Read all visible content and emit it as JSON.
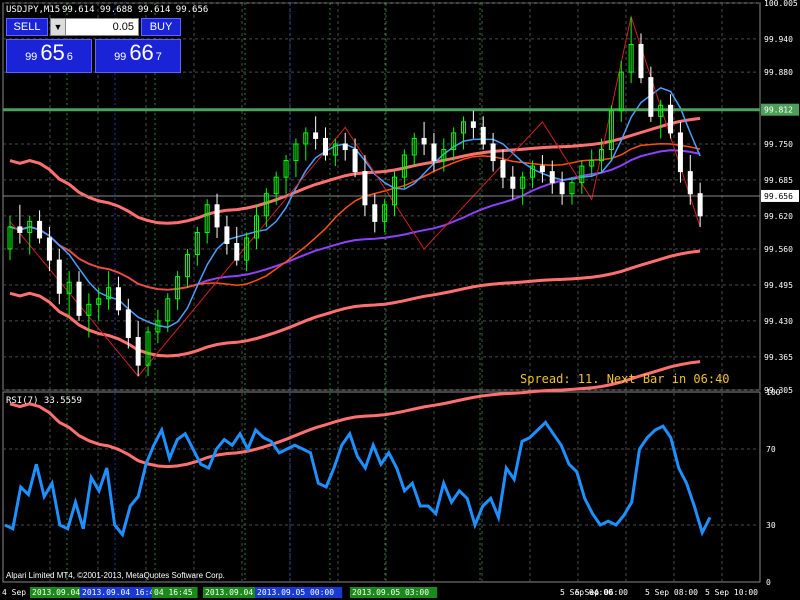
{
  "header": {
    "symbol_info": "USDJPY,M15",
    "ohlc": "99.614 99.688 99.614 99.656"
  },
  "trade_panel": {
    "sell_label": "SELL",
    "buy_label": "BUY",
    "lot_value": "0.05",
    "bid_prefix": "99",
    "bid_big": "65",
    "bid_sup": "6",
    "ask_prefix": "99",
    "ask_big": "66",
    "ask_sup": "7"
  },
  "status": {
    "spread_text": "Spread: 11. Next Bar in 06:40",
    "copyright": "Alpari Limited MT4, ©2001-2013, MetaQuotes Software Corp."
  },
  "colors": {
    "bull": "#00ff00",
    "bear": "#ffffff",
    "grid": "#4a4a4a",
    "hline": "#4ca05a",
    "rsi": "#1e90ff",
    "spread": "#f0c030"
  },
  "chart_data": [
    {
      "type": "candlestick",
      "title": "USDJPY,M15",
      "ylim": [
        99.305,
        100.005
      ],
      "y_ticks": [
        100.005,
        99.94,
        99.88,
        99.812,
        99.75,
        99.685,
        99.656,
        99.62,
        99.56,
        99.495,
        99.43,
        99.365,
        99.305
      ],
      "highlight_level": 99.812,
      "current_price": 99.656,
      "candles": [
        [
          99.56,
          99.62,
          99.54,
          99.6
        ],
        [
          99.6,
          99.64,
          99.57,
          99.59
        ],
        [
          99.59,
          99.62,
          99.55,
          99.61
        ],
        [
          99.61,
          99.63,
          99.57,
          99.58
        ],
        [
          99.58,
          99.6,
          99.52,
          99.54
        ],
        [
          99.54,
          99.56,
          99.46,
          99.48
        ],
        [
          99.48,
          99.52,
          99.44,
          99.5
        ],
        [
          99.5,
          99.52,
          99.43,
          99.44
        ],
        [
          99.44,
          99.48,
          99.4,
          99.46
        ],
        [
          99.46,
          99.49,
          99.43,
          99.47
        ],
        [
          99.47,
          99.52,
          99.45,
          99.49
        ],
        [
          99.49,
          99.51,
          99.44,
          99.45
        ],
        [
          99.45,
          99.47,
          99.38,
          99.4
        ],
        [
          99.4,
          99.43,
          99.33,
          99.35
        ],
        [
          99.35,
          99.42,
          99.33,
          99.41
        ],
        [
          99.41,
          99.45,
          99.39,
          99.43
        ],
        [
          99.43,
          99.48,
          99.41,
          99.47
        ],
        [
          99.47,
          99.52,
          99.45,
          99.51
        ],
        [
          99.51,
          99.56,
          99.49,
          99.55
        ],
        [
          99.55,
          99.6,
          99.53,
          99.59
        ],
        [
          99.59,
          99.65,
          99.57,
          99.64
        ],
        [
          99.64,
          99.66,
          99.58,
          99.6
        ],
        [
          99.6,
          99.62,
          99.55,
          99.57
        ],
        [
          99.57,
          99.6,
          99.53,
          99.54
        ],
        [
          99.54,
          99.59,
          99.52,
          99.58
        ],
        [
          99.58,
          99.64,
          99.56,
          99.62
        ],
        [
          99.62,
          99.67,
          99.6,
          99.66
        ],
        [
          99.66,
          99.7,
          99.64,
          99.69
        ],
        [
          99.69,
          99.73,
          99.66,
          99.72
        ],
        [
          99.72,
          99.76,
          99.69,
          99.75
        ],
        [
          99.75,
          99.78,
          99.72,
          99.77
        ],
        [
          99.77,
          99.8,
          99.74,
          99.76
        ],
        [
          99.76,
          99.78,
          99.72,
          99.73
        ],
        [
          99.73,
          99.76,
          99.71,
          99.75
        ],
        [
          99.75,
          99.77,
          99.72,
          99.74
        ],
        [
          99.74,
          99.76,
          99.69,
          99.7
        ],
        [
          99.7,
          99.73,
          99.62,
          99.64
        ],
        [
          99.64,
          99.66,
          99.59,
          99.61
        ],
        [
          99.61,
          99.65,
          99.59,
          99.64
        ],
        [
          99.64,
          99.7,
          99.62,
          99.69
        ],
        [
          99.69,
          99.74,
          99.67,
          99.73
        ],
        [
          99.73,
          99.77,
          99.71,
          99.76
        ],
        [
          99.76,
          99.79,
          99.73,
          99.75
        ],
        [
          99.75,
          99.77,
          99.7,
          99.72
        ],
        [
          99.72,
          99.76,
          99.7,
          99.74
        ],
        [
          99.74,
          99.78,
          99.72,
          99.77
        ],
        [
          99.77,
          99.8,
          99.74,
          99.79
        ],
        [
          99.79,
          99.81,
          99.76,
          99.78
        ],
        [
          99.78,
          99.8,
          99.74,
          99.75
        ],
        [
          99.75,
          99.77,
          99.7,
          99.72
        ],
        [
          99.72,
          99.74,
          99.67,
          99.69
        ],
        [
          99.69,
          99.71,
          99.65,
          99.67
        ],
        [
          99.67,
          99.7,
          99.64,
          99.69
        ],
        [
          99.69,
          99.72,
          99.67,
          99.71
        ],
        [
          99.71,
          99.73,
          99.68,
          99.7
        ],
        [
          99.7,
          99.72,
          99.66,
          99.68
        ],
        [
          99.68,
          99.7,
          99.64,
          99.66
        ],
        [
          99.66,
          99.69,
          99.64,
          99.68
        ],
        [
          99.68,
          99.72,
          99.66,
          99.71
        ],
        [
          99.71,
          99.74,
          99.69,
          99.72
        ],
        [
          99.72,
          99.76,
          99.7,
          99.74
        ],
        [
          99.74,
          99.82,
          99.72,
          99.81
        ],
        [
          99.81,
          99.9,
          99.79,
          99.88
        ],
        [
          99.88,
          99.98,
          99.86,
          99.93
        ],
        [
          99.93,
          99.95,
          99.86,
          99.87
        ],
        [
          99.87,
          99.89,
          99.79,
          99.8
        ],
        [
          99.8,
          99.83,
          99.76,
          99.82
        ],
        [
          99.82,
          99.84,
          99.76,
          99.77
        ],
        [
          99.77,
          99.79,
          99.68,
          99.7
        ],
        [
          99.7,
          99.73,
          99.64,
          99.66
        ],
        [
          99.66,
          99.68,
          99.6,
          99.62
        ]
      ]
    },
    {
      "type": "line",
      "title": "RSI(7) 33.5559",
      "ylim": [
        0,
        100
      ],
      "y_ticks": [
        100,
        70,
        30,
        0
      ],
      "x_labels": [
        "4 Sep",
        "5 Sep 04:00",
        "5 Sep 06:00",
        "5 Sep 08:00",
        "5 Sep 10:00"
      ],
      "x_label_positions": [
        0,
        77,
        91,
        103,
        117
      ],
      "highlighted_labels": [
        "2013.09.04",
        "2013.09.04 16:45",
        "04 16:45",
        "2013.09.04",
        "2013.09.05 00:00",
        "2013.09.05 03:00"
      ],
      "series": [
        {
          "values": [
            30,
            28,
            50,
            46,
            62,
            45,
            52,
            30,
            28,
            42,
            28,
            55,
            48,
            60,
            30,
            25,
            40,
            45,
            62,
            72,
            80,
            65,
            75,
            78,
            70,
            62,
            60,
            70,
            75,
            72,
            78,
            70,
            80,
            76,
            74,
            68,
            70,
            72,
            70,
            68,
            52,
            50,
            60,
            72,
            78,
            66,
            60,
            72,
            62,
            68,
            60,
            48,
            52,
            40,
            40,
            36,
            52,
            42,
            48,
            44,
            30,
            40,
            44,
            34,
            60,
            54,
            74,
            76,
            80,
            84,
            78,
            72,
            62,
            58,
            44,
            36,
            30,
            32,
            30,
            35,
            42,
            70,
            76,
            80,
            82,
            76,
            60,
            52,
            40,
            26,
            34
          ]
        }
      ]
    }
  ]
}
